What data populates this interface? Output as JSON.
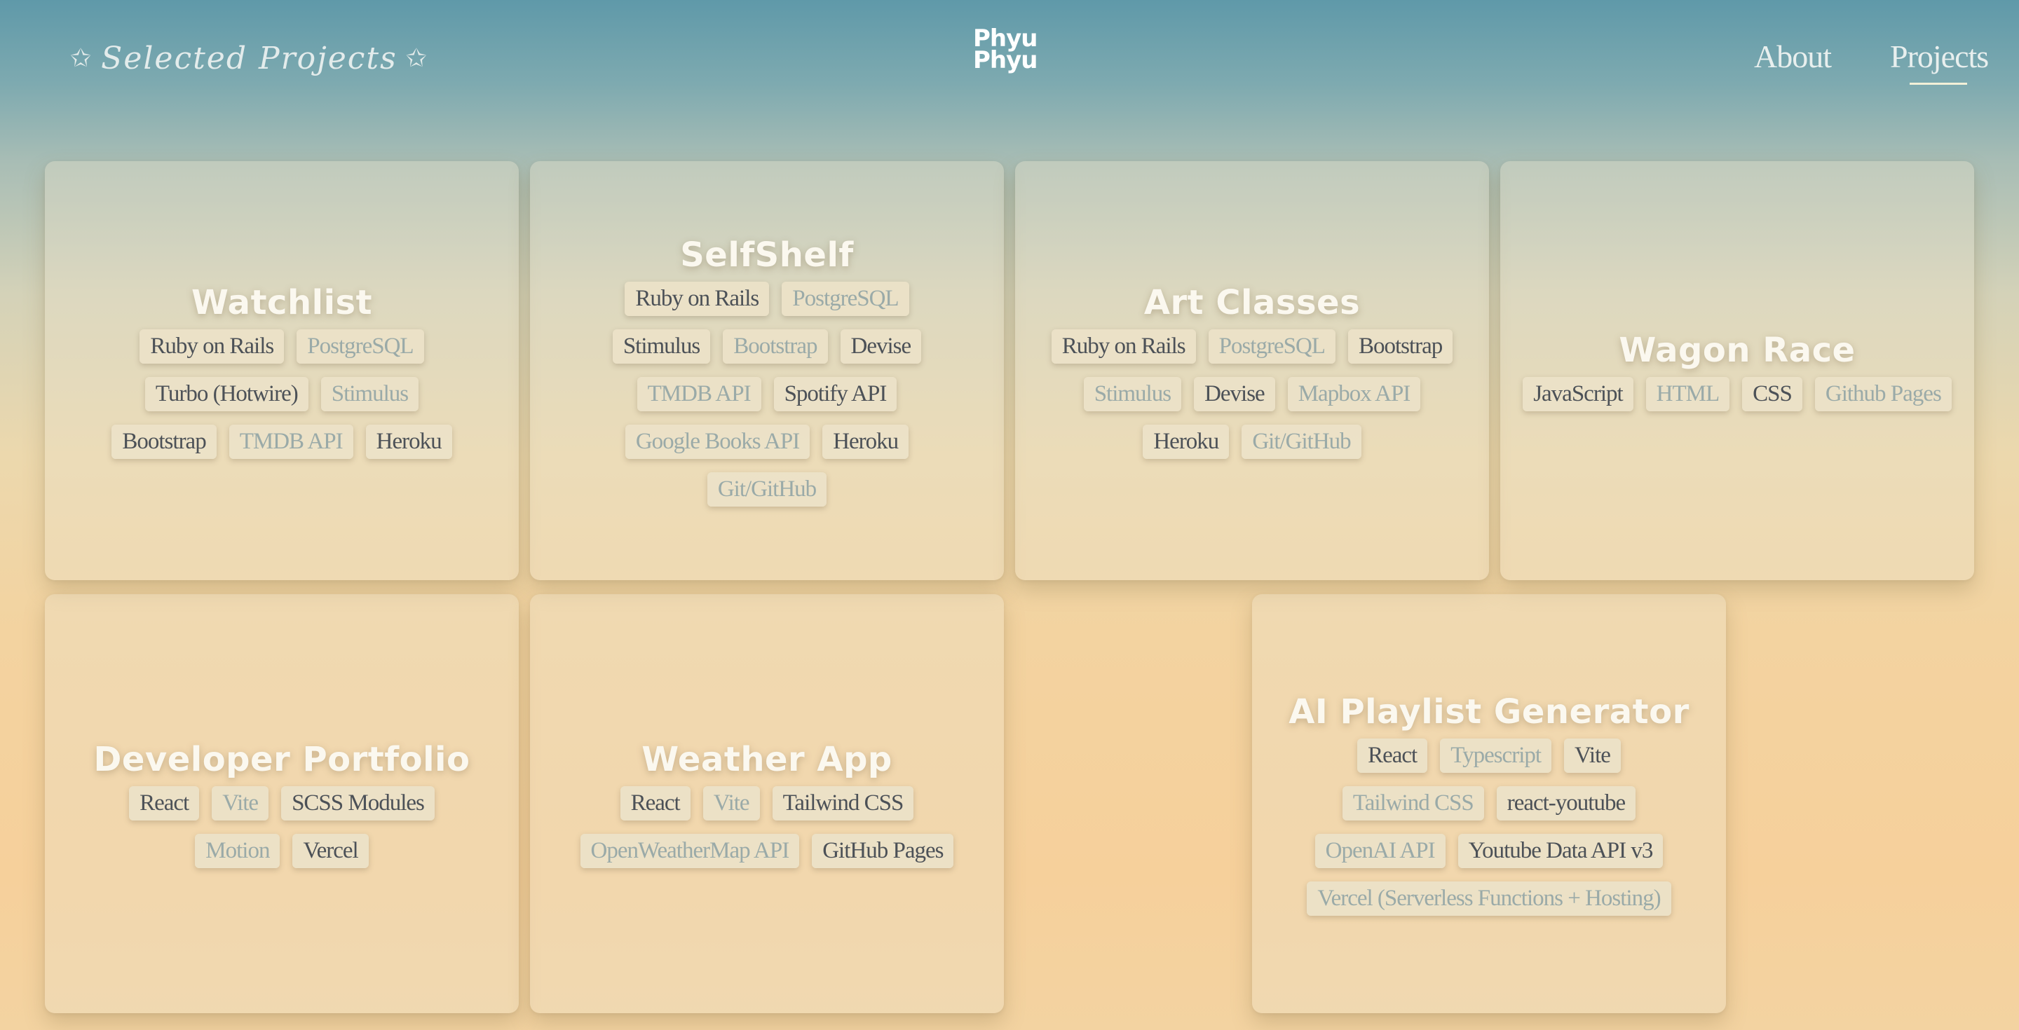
{
  "header": {
    "brand": "Selected Projects",
    "logo_line1": "Phyu",
    "logo_line2": "Phyu",
    "nav": [
      {
        "label": "About",
        "active": false
      },
      {
        "label": "Projects",
        "active": true
      }
    ]
  },
  "projects": [
    {
      "title": "Watchlist",
      "tags": [
        {
          "label": "Ruby on Rails",
          "tone": "dark"
        },
        {
          "label": "PostgreSQL",
          "tone": "light"
        },
        {
          "label": "Turbo (Hotwire)",
          "tone": "dark"
        },
        {
          "label": "Stimulus",
          "tone": "light"
        },
        {
          "label": "Bootstrap",
          "tone": "dark"
        },
        {
          "label": "TMDB API",
          "tone": "light"
        },
        {
          "label": "Heroku",
          "tone": "dark"
        }
      ]
    },
    {
      "title": "SelfShelf",
      "tags": [
        {
          "label": "Ruby on Rails",
          "tone": "dark"
        },
        {
          "label": "PostgreSQL",
          "tone": "light"
        },
        {
          "label": "Stimulus",
          "tone": "dark"
        },
        {
          "label": "Bootstrap",
          "tone": "light"
        },
        {
          "label": "Devise",
          "tone": "dark"
        },
        {
          "label": "TMDB API",
          "tone": "light"
        },
        {
          "label": "Spotify API",
          "tone": "dark"
        },
        {
          "label": "Google Books API",
          "tone": "light"
        },
        {
          "label": "Heroku",
          "tone": "dark"
        },
        {
          "label": "Git/GitHub",
          "tone": "light"
        }
      ]
    },
    {
      "title": "Art Classes",
      "tags": [
        {
          "label": "Ruby on Rails",
          "tone": "dark"
        },
        {
          "label": "PostgreSQL",
          "tone": "light"
        },
        {
          "label": "Bootstrap",
          "tone": "dark"
        },
        {
          "label": "Stimulus",
          "tone": "light"
        },
        {
          "label": "Devise",
          "tone": "dark"
        },
        {
          "label": "Mapbox API",
          "tone": "light"
        },
        {
          "label": "Heroku",
          "tone": "dark"
        },
        {
          "label": "Git/GitHub",
          "tone": "light"
        }
      ]
    },
    {
      "title": "Wagon Race",
      "tags": [
        {
          "label": "JavaScript",
          "tone": "dark"
        },
        {
          "label": "HTML",
          "tone": "light"
        },
        {
          "label": "CSS",
          "tone": "dark"
        },
        {
          "label": "Github Pages",
          "tone": "light"
        }
      ]
    },
    {
      "title": "Developer Portfolio",
      "tags": [
        {
          "label": "React",
          "tone": "dark"
        },
        {
          "label": "Vite",
          "tone": "light"
        },
        {
          "label": "SCSS Modules",
          "tone": "dark"
        },
        {
          "label": "Motion",
          "tone": "light"
        },
        {
          "label": "Vercel",
          "tone": "dark"
        }
      ]
    },
    {
      "title": "Weather App",
      "tags": [
        {
          "label": "React",
          "tone": "dark"
        },
        {
          "label": "Vite",
          "tone": "light"
        },
        {
          "label": "Tailwind CSS",
          "tone": "dark"
        },
        {
          "label": "OpenWeatherMap API",
          "tone": "light"
        },
        {
          "label": "GitHub Pages",
          "tone": "dark"
        }
      ]
    },
    {
      "title": "AI Playlist Generator",
      "tags": [
        {
          "label": "React",
          "tone": "dark"
        },
        {
          "label": "Typescript",
          "tone": "light"
        },
        {
          "label": "Vite",
          "tone": "dark"
        },
        {
          "label": "Tailwind CSS",
          "tone": "light"
        },
        {
          "label": "react-youtube",
          "tone": "dark"
        },
        {
          "label": "OpenAI API",
          "tone": "light"
        },
        {
          "label": "Youtube Data API v3",
          "tone": "dark"
        },
        {
          "label": "Vercel (Serverless Functions + Hosting)",
          "tone": "light"
        }
      ]
    }
  ]
}
